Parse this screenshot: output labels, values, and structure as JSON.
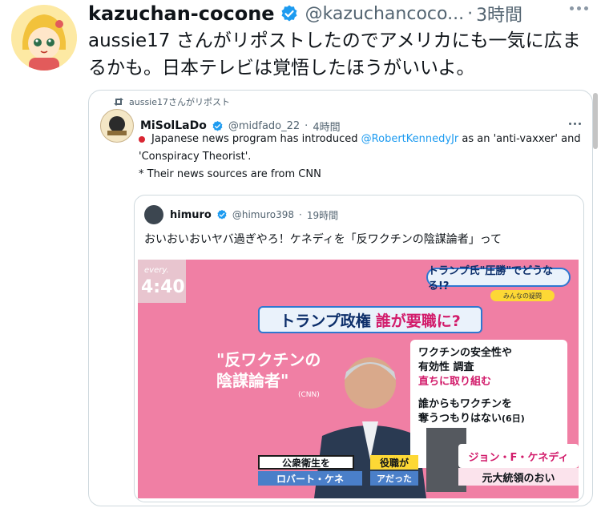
{
  "tweet": {
    "display_name": "kazuchan-cocone",
    "handle": "@kazuchancoco...",
    "dot": "·",
    "time": "3時間",
    "text": "aussie17 さんがリポストしたのでアメリカにも一気に広まるかも。日本テレビは覚悟したほうがいいよ。"
  },
  "quoted": {
    "repost_label": "aussie17さんがリポスト",
    "display_name": "MiSolLaDo",
    "handle": "@midfado_22",
    "dot": "·",
    "time": "4時間",
    "text_1": "Japanese news program has introduced",
    "mention": "@RobertKennedyJr",
    "text_2": "as an 'anti-vaxxer' and 'Conspiracy Theorist'.",
    "text_3": "* Their news sources are from CNN"
  },
  "inner": {
    "display_name": "himuro",
    "handle": "@himuro398",
    "dot": "·",
    "time": "19時間",
    "text": "おいおいおいヤバ過ぎやろ！ケネディを「反ワクチンの陰謀論者」って"
  },
  "tv": {
    "clock_label": "every.",
    "clock": "4:40",
    "top_tag": "トランプ氏\"圧勝\"でどうなる!?",
    "sub_tag": "みんなの疑問",
    "banner_1": "トランプ政権",
    "banner_2": "誰が要職に?",
    "quote_line_1": "\"反ワクチンの",
    "quote_line_2": "陰謀論者\"",
    "cnn": "(CNN)",
    "pane_1": "ワクチンの安全性や",
    "pane_2": "有効性 調査",
    "pane_3": "直ちに取り組む",
    "pane_4": "誰からもワクチンを",
    "pane_5": "奪うつもりはない",
    "pane_6": "(6日)",
    "caption_l": "公衆衛生を",
    "caption_l2": "ロバート・ケネ",
    "mid_cap": "役職が",
    "mid_cap2": "アだった",
    "caption_r": "ジョン・F・ケネディ",
    "caption_r2": "元大統領のおい"
  },
  "colors": {
    "verified": "#1d9bf0",
    "text_primary": "#0f1419",
    "text_secondary": "#536471",
    "link": "#1d9bf0",
    "tv_bg": "#f07fa4"
  }
}
